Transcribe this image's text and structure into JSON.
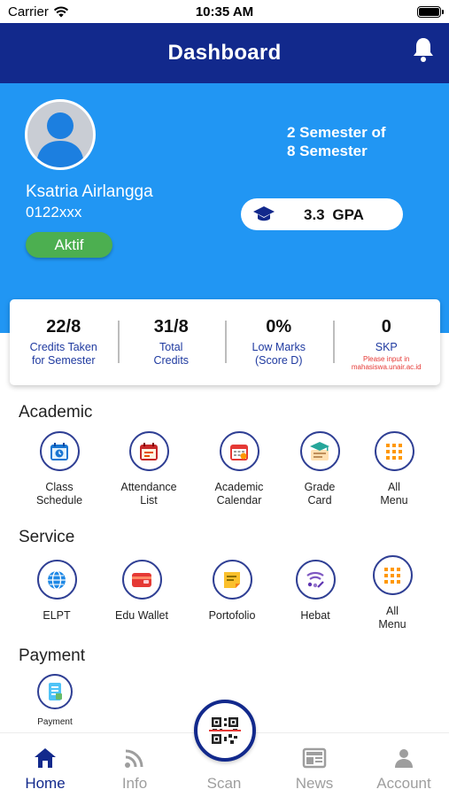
{
  "status_bar": {
    "carrier": "Carrier",
    "time": "10:35 AM"
  },
  "header": {
    "title": "Dashboard"
  },
  "profile": {
    "name": "Ksatria Airlangga",
    "nim": "0122xxx",
    "status": "Aktif",
    "semester_line1": "2 Semester of",
    "semester_line2": "8 Semester",
    "gpa": "3.3  GPA"
  },
  "stats": [
    {
      "value": "22/8",
      "label_1": "Credits Taken",
      "label_2": "for Semester",
      "note_1": "",
      "note_2": ""
    },
    {
      "value": "31/8",
      "label_1": "Total",
      "label_2": "Credits",
      "note_1": "",
      "note_2": ""
    },
    {
      "value": "0%",
      "label_1": "Low Marks",
      "label_2": "(Score D)",
      "note_1": "",
      "note_2": ""
    },
    {
      "value": "0",
      "label_1": "SKP",
      "label_2": "",
      "note_1": "Please input in",
      "note_2": "mahasiswa.unair.ac.id"
    }
  ],
  "academic": {
    "title": "Academic",
    "items": [
      {
        "line1": "Class",
        "line2": "Schedule",
        "icon": "class-schedule-icon"
      },
      {
        "line1": "Attendance",
        "line2": "List",
        "icon": "attendance-list-icon"
      },
      {
        "line1": "Academic",
        "line2": "Calendar",
        "icon": "academic-calendar-icon"
      },
      {
        "line1": "Grade",
        "line2": "Card",
        "icon": "grade-card-icon"
      },
      {
        "line1": "All",
        "line2": "Menu",
        "icon": "grid-menu-icon"
      }
    ]
  },
  "service": {
    "title": "Service",
    "items": [
      {
        "line1": "ELPT",
        "line2": "",
        "icon": "globe-icon"
      },
      {
        "line1": "Edu Wallet",
        "line2": "",
        "icon": "wallet-icon"
      },
      {
        "line1": "Portofolio",
        "line2": "",
        "icon": "note-icon"
      },
      {
        "line1": "Hebat",
        "line2": "",
        "icon": "hebat-icon"
      },
      {
        "line1": "All",
        "line2": "Menu",
        "icon": "grid-menu-icon"
      }
    ]
  },
  "payment": {
    "title": "Payment",
    "items": [
      {
        "line1": "Payment",
        "icon": "payment-icon"
      }
    ]
  },
  "bottom_nav": {
    "home": "Home",
    "info": "Info",
    "scan": "Scan",
    "news": "News",
    "account": "Account"
  },
  "colors": {
    "primary": "#12298c",
    "hero": "#2196f3",
    "active_badge": "#4caf50",
    "inactive_nav": "#9e9e9e"
  }
}
